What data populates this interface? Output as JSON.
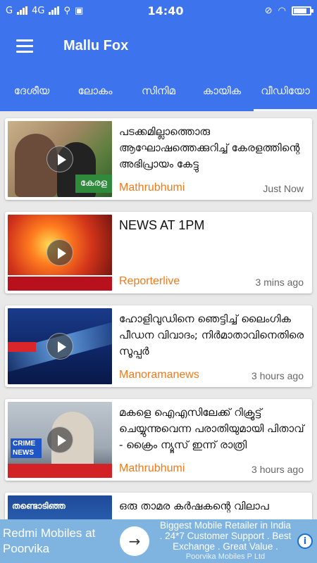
{
  "status_bar": {
    "carrier": "G",
    "network": "4G",
    "time": "14:40",
    "battery_level": 0.75
  },
  "app": {
    "title": "Mallu Fox",
    "accent_color": "#3d73ec"
  },
  "tabs": [
    {
      "label": "ദേശീയ"
    },
    {
      "label": "ലോകം"
    },
    {
      "label": "സിനിമ"
    },
    {
      "label": "കായിക"
    },
    {
      "label": "വീഡിയോ",
      "active": true
    }
  ],
  "feed": [
    {
      "headline": "പടക്കമില്ലാത്തൊരു ആഘോഷത്തെക്കുറിച്ച് കേരളത്തിന്റെ അഭിപ്രായം കേട്ടു",
      "source": "Mathrubhumi",
      "time": "Just Now",
      "thumb_text": "കേരള"
    },
    {
      "headline": "NEWS AT 1PM",
      "source": "Reporterlive",
      "time": "3 mins ago"
    },
    {
      "headline": "ഹോളിവുഡിനെ ഞെട്ടിച്ച് ലൈംഗിക പീഡന വിവാദം; നിർമാതാവിനെതിരെ സൂപ്പർ",
      "source": "Manoramanews",
      "time": "3 hours ago"
    },
    {
      "headline": "മകളെ ഐഎസിലേക്ക് റിക്രൂട്ട് ചെയ്യുന്നുവെന്ന പരാതിയുമായി പിതാവ് - ക്രൈം ന്യൂസ് ഇന്ന് രാത്രി",
      "source": "Mathrubhumi",
      "time": "3 hours ago",
      "thumb_text": "CRIME NEWS"
    },
    {
      "headline": "ഒരു താമര കർഷകന്റെ വിലാപ",
      "source": "",
      "time": "",
      "thumb_text": "തണ്ടൊടിഞ്ഞ"
    }
  ],
  "ad": {
    "left_text": "Redmi Mobiles at Poorvika",
    "right_text": "Biggest Mobile Retailer in India . 24*7 Customer Support . Best Exchange . Great Value .",
    "advertiser": "Poorvika Mobiles P Ltd",
    "arrow_icon": "→",
    "info_icon": "i"
  }
}
